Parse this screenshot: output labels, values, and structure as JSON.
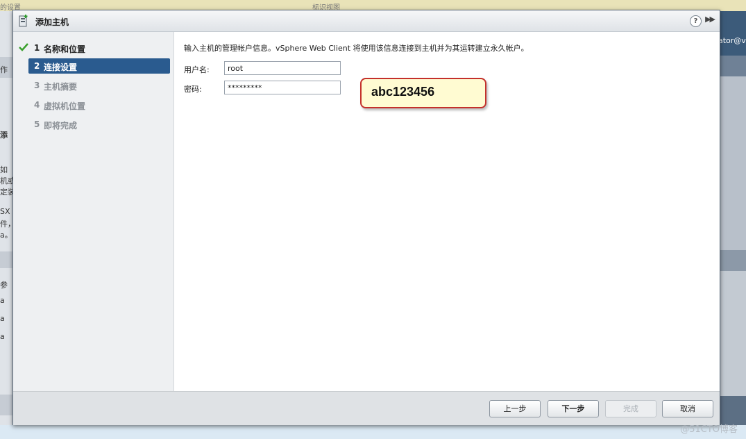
{
  "background": {
    "top_text": [
      "的设置",
      "标识视图"
    ],
    "right_user_text": "ator@v",
    "left_texts": [
      "作",
      "添",
      "如",
      "机或",
      "定装",
      "SX",
      "件，",
      "a。",
      "参",
      "a",
      "a",
      "a"
    ],
    "watermark": "@51CTO博客"
  },
  "dialog": {
    "title": "添加主机",
    "help_label": "?",
    "expand_label": "▶▶"
  },
  "steps": [
    {
      "num": "1",
      "label": "名称和位置",
      "state": "done"
    },
    {
      "num": "2",
      "label": "连接设置",
      "state": "active"
    },
    {
      "num": "3",
      "label": "主机摘要",
      "state": "pending"
    },
    {
      "num": "4",
      "label": "虚拟机位置",
      "state": "pending"
    },
    {
      "num": "5",
      "label": "即将完成",
      "state": "pending"
    }
  ],
  "content": {
    "description": "输入主机的管理帐户信息。vSphere Web Client 将使用该信息连接到主机并为其运转建立永久帐户。",
    "username_label": "用户名:",
    "username_value": "root",
    "password_label": "密码:",
    "password_value": "*********",
    "callout_text": "abc123456"
  },
  "footer": {
    "back_label": "上一步",
    "next_label": "下一步",
    "finish_label": "完成",
    "cancel_label": "取消"
  },
  "colors": {
    "active_step": "#2a5b8f",
    "callout_border": "#c4302b",
    "callout_fill": "#fffbd2",
    "check": "#3aa02c"
  }
}
